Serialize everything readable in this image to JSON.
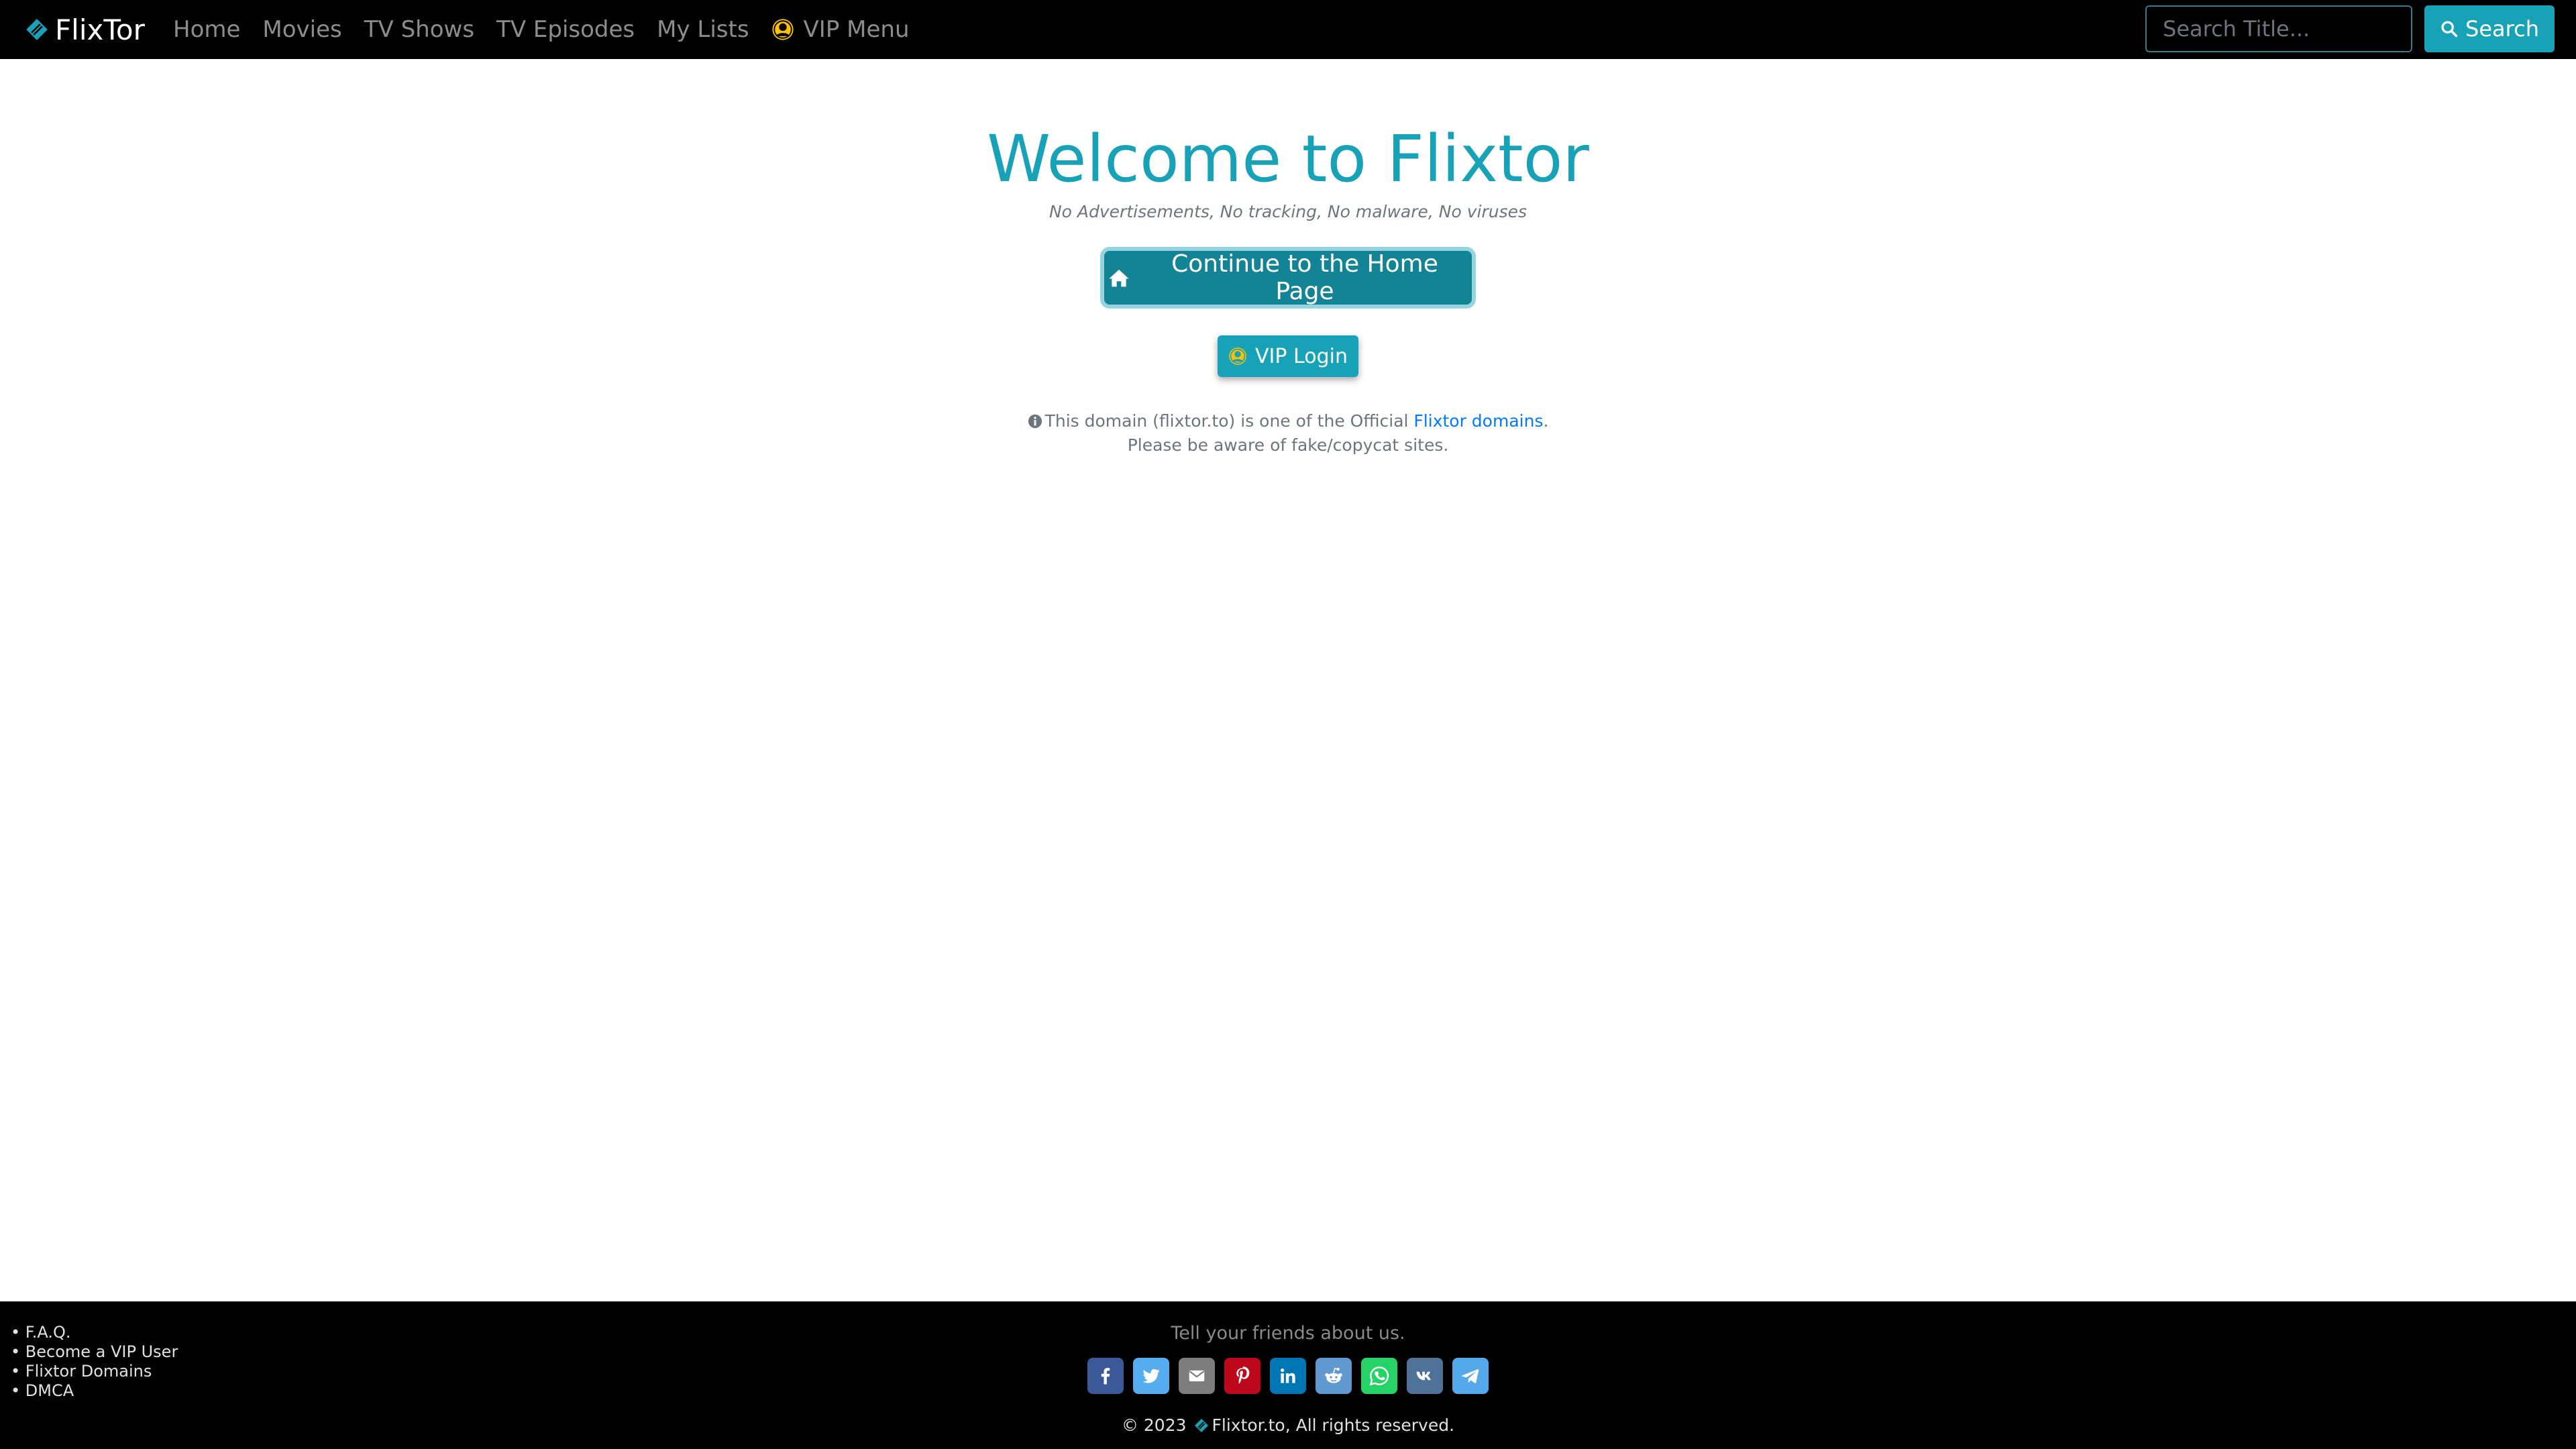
{
  "navbar": {
    "brand": "FlixTor",
    "links": [
      {
        "label": "Home"
      },
      {
        "label": "Movies"
      },
      {
        "label": "TV Shows"
      },
      {
        "label": "TV Episodes"
      },
      {
        "label": "My Lists"
      },
      {
        "label": "VIP Menu",
        "icon": "user-circle-icon"
      }
    ],
    "search_placeholder": "Search Title...",
    "search_button": "Search"
  },
  "main": {
    "title": "Welcome to Flixtor",
    "tagline": "No Advertisements, No tracking, No malware, No viruses",
    "home_button": "Continue to the Home Page",
    "vip_login_button": "VIP Login",
    "domain_note_pre": "This domain (flixtor.to) is one of the Official ",
    "domain_note_link": "Flixtor domains",
    "domain_note_post": ".",
    "domain_note_line2": "Please be aware of fake/copycat sites."
  },
  "footer": {
    "links": [
      "F.A.Q.",
      "Become a VIP User",
      "Flixtor Domains",
      "DMCA"
    ],
    "share_text": "Tell your friends about us.",
    "share_buttons": [
      {
        "name": "facebook-icon",
        "color": "#3b5998"
      },
      {
        "name": "twitter-icon",
        "color": "#55acee"
      },
      {
        "name": "email-icon",
        "color": "#7d7d7d"
      },
      {
        "name": "pinterest-icon",
        "color": "#bd081c"
      },
      {
        "name": "linkedin-icon",
        "color": "#0077b5"
      },
      {
        "name": "reddit-icon",
        "color": "#5f99cf"
      },
      {
        "name": "whatsapp-icon",
        "color": "#25d366"
      },
      {
        "name": "vk-icon",
        "color": "#507299"
      },
      {
        "name": "telegram-icon",
        "color": "#54a9eb"
      }
    ],
    "copyright_pre": "© 2023",
    "copyright_post": "Flixtor.to, All rights reserved."
  },
  "colors": {
    "accent": "#17a2b8",
    "navbar_bg": "#000000",
    "link": "#007bff",
    "vip_yellow": "#ffc107"
  }
}
